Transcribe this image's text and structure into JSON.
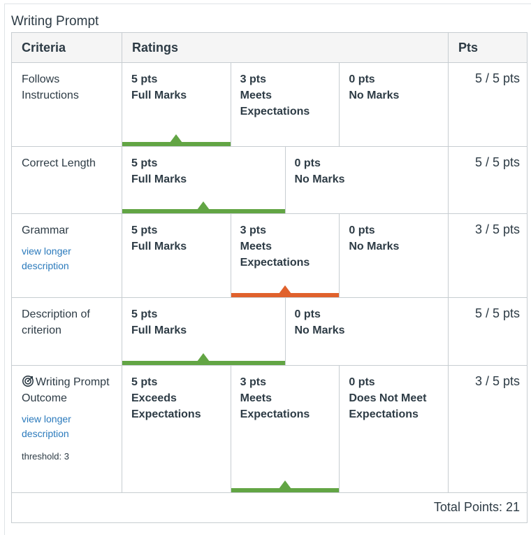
{
  "title": "Writing Prompt",
  "headers": {
    "criteria": "Criteria",
    "ratings": "Ratings",
    "pts": "Pts"
  },
  "colors": {
    "selected_full": "#62a544",
    "selected_partial": "#e0612c",
    "link": "#2b7abc"
  },
  "rows": [
    {
      "criterion": "Follows Instructions",
      "points": "5 / 5 pts",
      "ratings": [
        {
          "pts": "5 pts",
          "label": "Full Marks",
          "selected": "green"
        },
        {
          "pts": "3 pts",
          "label": "Meets Expectations",
          "selected": ""
        },
        {
          "pts": "0 pts",
          "label": "No Marks",
          "selected": ""
        }
      ]
    },
    {
      "criterion": "Correct Length",
      "points": "5 / 5 pts",
      "ratings": [
        {
          "pts": "5 pts",
          "label": "Full Marks",
          "selected": "green"
        },
        {
          "pts": "0 pts",
          "label": "No Marks",
          "selected": ""
        }
      ]
    },
    {
      "criterion": "Grammar",
      "long_description_link": "view longer description",
      "points": "3 / 5 pts",
      "ratings": [
        {
          "pts": "5 pts",
          "label": "Full Marks",
          "selected": ""
        },
        {
          "pts": "3 pts",
          "label": "Meets Expectations",
          "selected": "orange"
        },
        {
          "pts": "0 pts",
          "label": "No Marks",
          "selected": ""
        }
      ]
    },
    {
      "criterion": "Description of criterion",
      "points": "5 / 5 pts",
      "ratings": [
        {
          "pts": "5 pts",
          "label": "Full Marks",
          "selected": "green"
        },
        {
          "pts": "0 pts",
          "label": "No Marks",
          "selected": ""
        }
      ]
    },
    {
      "criterion": "Writing Prompt Outcome",
      "outcome_icon": "target-icon",
      "long_description_link": "view longer description",
      "threshold": "threshold: 3",
      "points": "3 / 5 pts",
      "ratings": [
        {
          "pts": "5 pts",
          "label": "Exceeds Expectations",
          "selected": ""
        },
        {
          "pts": "3 pts",
          "label": "Meets Expectations",
          "selected": "green"
        },
        {
          "pts": "0 pts",
          "label": "Does Not Meet Expectations",
          "selected": ""
        }
      ]
    }
  ],
  "total": "Total Points: 21"
}
